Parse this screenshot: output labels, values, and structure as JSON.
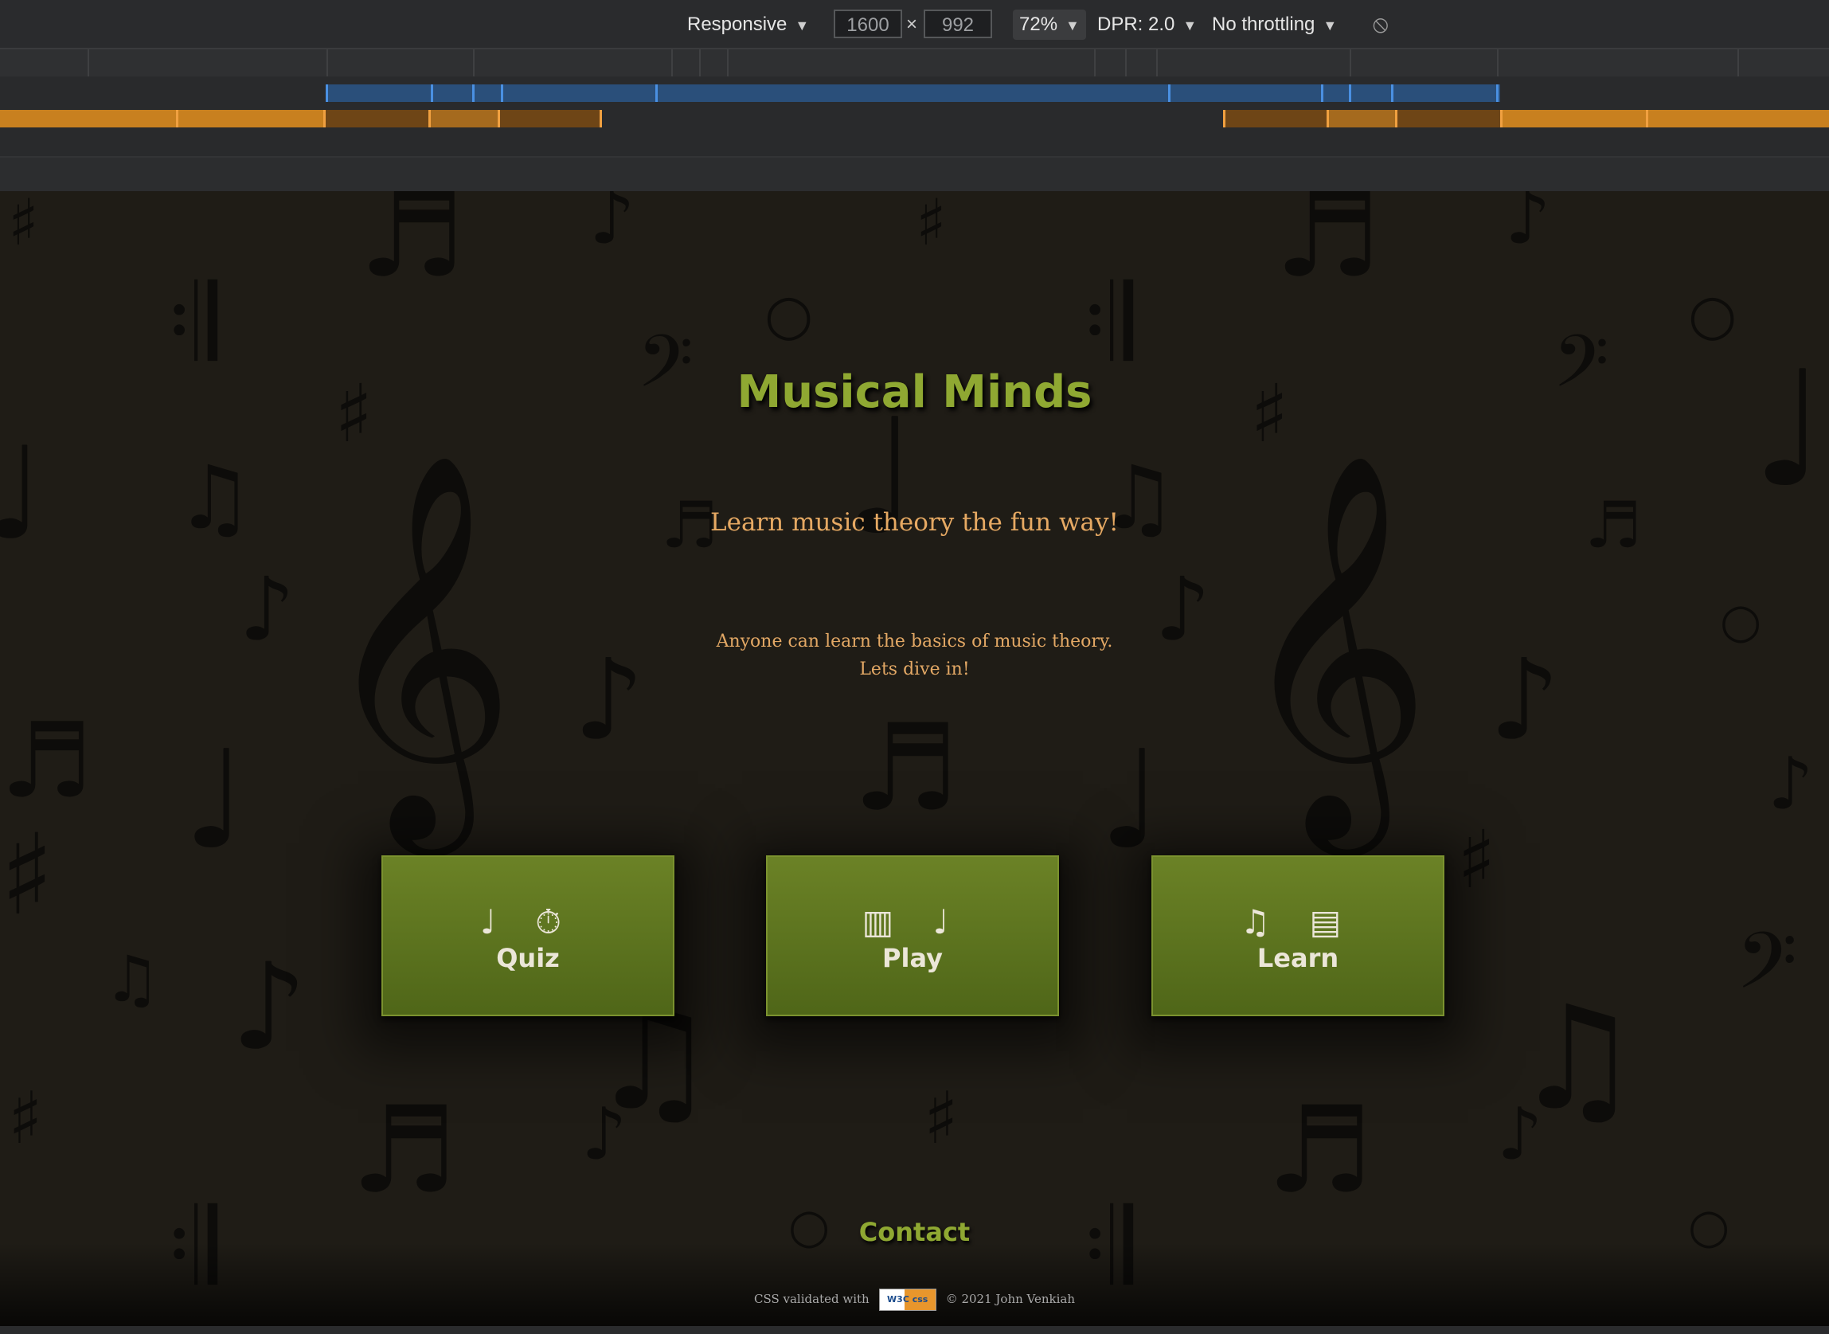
{
  "devtools": {
    "device": "Responsive",
    "width": "1600",
    "height": "992",
    "times": "×",
    "zoom": "72%",
    "dpr": "DPR: 2.0",
    "throttling": "No throttling",
    "dropdown_arrow": "▼",
    "rotate_icon": "⦸"
  },
  "page": {
    "title": "Musical Minds",
    "tagline": "Learn music theory the fun way!",
    "intro_line1": "Anyone can learn the basics of music theory.",
    "intro_line2": "Lets dive in!",
    "cards": [
      {
        "label": "Quiz",
        "icons": "♩ ⏱"
      },
      {
        "label": "Play",
        "icons": "▥ ♩"
      },
      {
        "label": "Learn",
        "icons": "♫ ▤"
      }
    ],
    "contact": "Contact",
    "footer_validated": "CSS validated with",
    "footer_badge": "W3C css",
    "footer_copyright": "© 2021 John Venkiah"
  },
  "colors": {
    "title": "#8fa832",
    "tagline": "#e6a963",
    "card": "#6b8226",
    "background": "#1f1c16"
  }
}
